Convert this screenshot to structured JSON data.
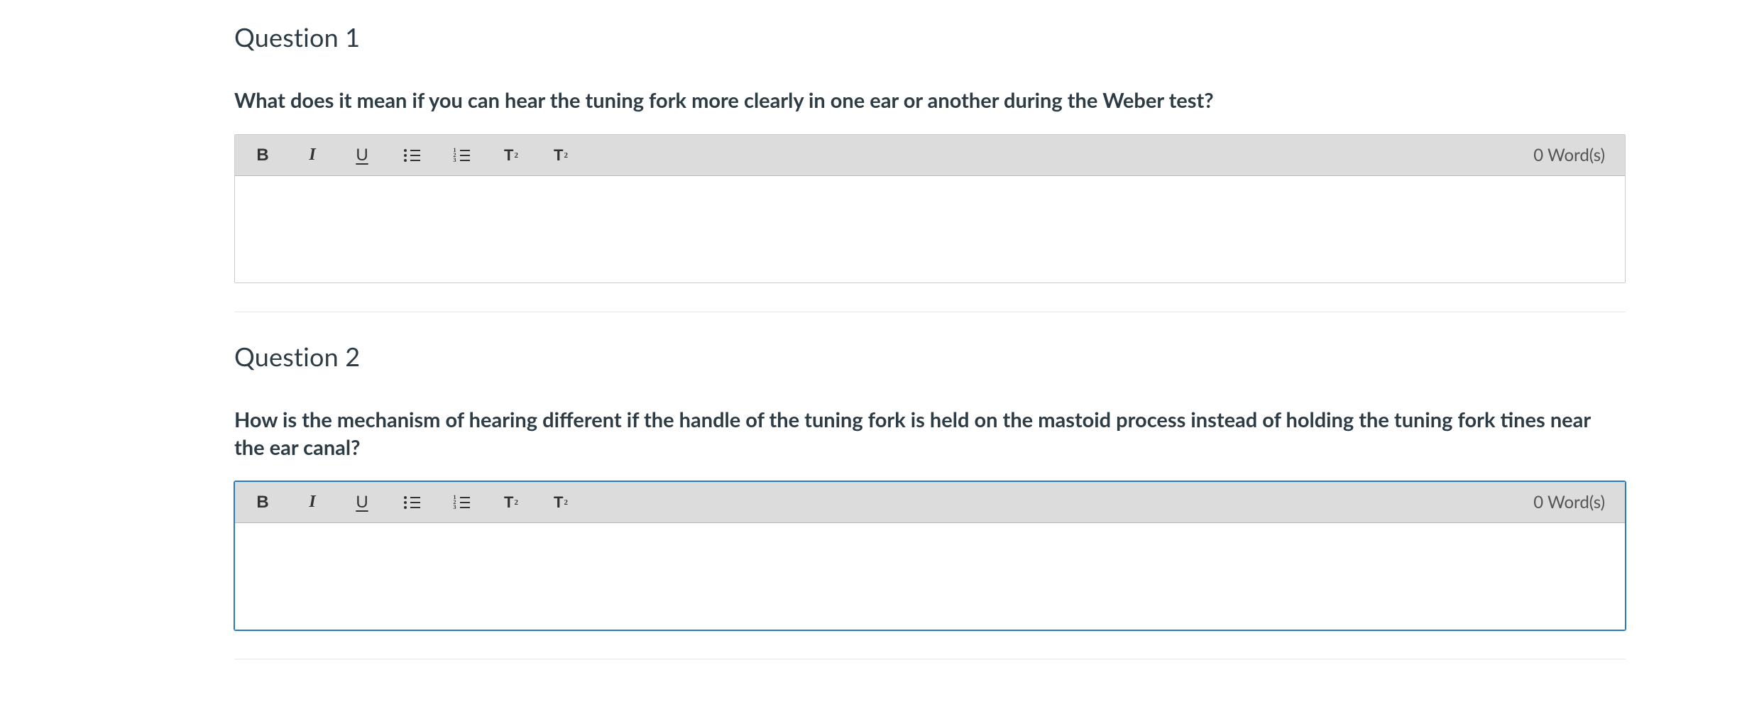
{
  "questions": [
    {
      "title": "Question 1",
      "prompt": "What does it mean if you can hear the tuning fork more clearly in one ear or another during the Weber test?",
      "word_count": "0 Word(s)",
      "answer": "",
      "focused": false
    },
    {
      "title": "Question 2",
      "prompt": "How is the mechanism of hearing different if the handle of the tuning fork is held on the mastoid process instead of holding the tuning fork tines near the ear canal?",
      "word_count": "0 Word(s)",
      "answer": "",
      "focused": true
    }
  ],
  "toolbar": {
    "bold": "B",
    "italic": "I",
    "underline": "U",
    "sup_base": "T",
    "sup_exp": "2",
    "sub_base": "T",
    "sub_exp": "2"
  }
}
